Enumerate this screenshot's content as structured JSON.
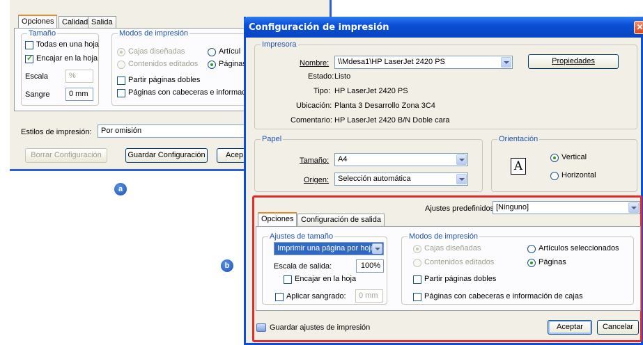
{
  "badges": {
    "a": "a",
    "b": "b"
  },
  "back_dialog": {
    "tabs": [
      "Opciones",
      "Calidad",
      "Salida"
    ],
    "size_group": {
      "title": "Tamaño",
      "all_in_one": "Todas en una hoja",
      "fit": "Encajar en la hoja",
      "scale_label": "Escala",
      "scale_value": "%",
      "bleed_label": "Sangre",
      "bleed_value": "0 mm"
    },
    "modes_group": {
      "title": "Modos de impresión",
      "designed": "Cajas diseñadas",
      "edited": "Contenidos editados",
      "articles": "Artícul",
      "pages": "Páginas",
      "split": "Partir páginas dobles",
      "headers": "Páginas con cabeceras e información c"
    },
    "styles_label": "Estilos de impresión:",
    "styles_value": "Por omisión",
    "clear_button": "Borrar Configuración",
    "save_button": "Guardar Configuración",
    "accept_button": "Acep"
  },
  "main_dialog": {
    "title": "Configuración de impresión",
    "printer": {
      "title": "Impresora",
      "name_label": "Nombre:",
      "name_value": "\\\\Mdesa1\\HP LaserJet 2420 PS",
      "properties": "Propiedades",
      "status_label": "Estado:",
      "status_value": "Listo",
      "type_label": "Tipo:",
      "type_value": "HP LaserJet 2420 PS",
      "location_label": "Ubicación:",
      "location_value": "Planta 3 Desarrollo Zona 3C4",
      "comment_label": "Comentario:",
      "comment_value": "HP LaserJet 2420 B/N Doble cara"
    },
    "paper": {
      "title": "Papel",
      "size_label": "Tamaño:",
      "size_value": "A4",
      "source_label": "Origen:",
      "source_value": "Selección automática"
    },
    "orientation": {
      "title": "Orientación",
      "icon_letter": "A",
      "vertical": "Vertical",
      "horizontal": "Horizontal"
    },
    "presets_label": "Ajustes predefinidos:",
    "presets_value": "[Ninguno]",
    "tabs": [
      "Opciones",
      "Configuración de salida"
    ],
    "size_settings": {
      "title": "Ajustes de tamaño",
      "mode_value": "Imprimir una página por hoja",
      "scale_label": "Escala de salida:",
      "scale_value": "100%",
      "fit": "Encajar en la hoja",
      "bleed": "Aplicar sangrado:",
      "bleed_value": "0 mm"
    },
    "print_modes": {
      "title": "Modos de impresión",
      "designed": "Cajas diseñadas",
      "edited": "Contenidos editados",
      "articles": "Artículos seleccionados",
      "pages": "Páginas",
      "split": "Partir páginas dobles",
      "headers": "Páginas con cabeceras e información de cajas"
    },
    "save_settings": "Guardar ajustes de impresión",
    "accept": "Aceptar",
    "cancel": "Cancelar"
  },
  "colors": {
    "title_bar": "#0a4fd6",
    "highlight": "#e22b2b",
    "group_title": "#1f52b0"
  }
}
